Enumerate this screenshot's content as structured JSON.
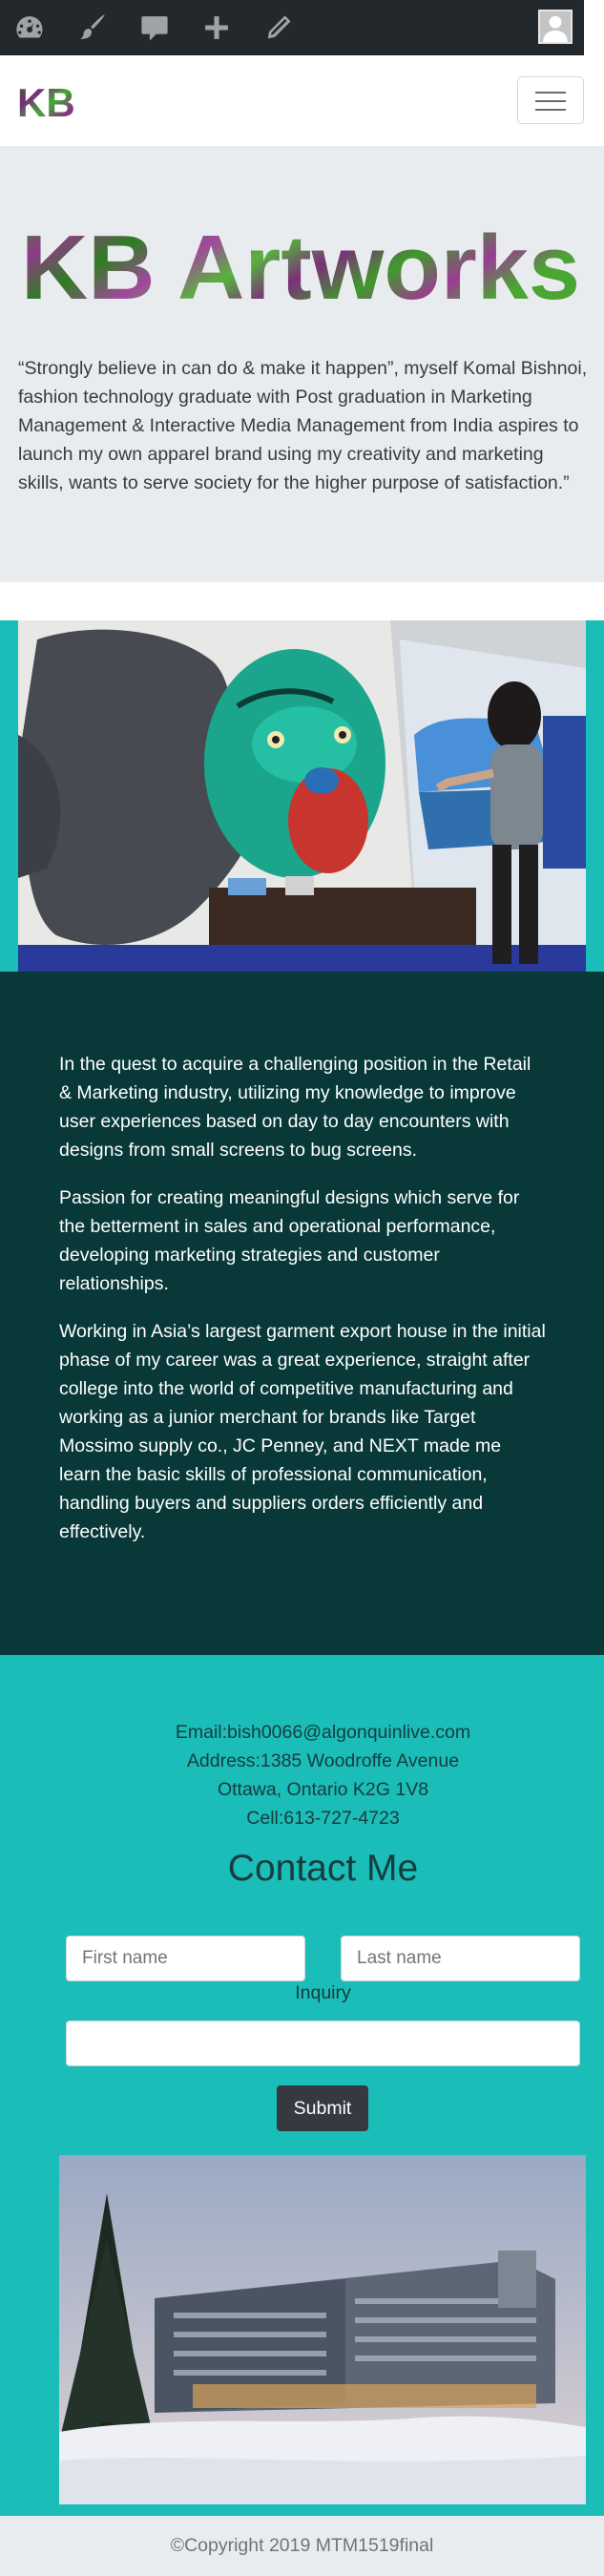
{
  "adminbar": {
    "icons": [
      "dashboard-icon",
      "brush-icon",
      "comment-icon",
      "plus-icon",
      "pencil-icon",
      "avatar-icon"
    ]
  },
  "navbar": {
    "brand": "KB"
  },
  "hero": {
    "title": "KB Artworks",
    "quote": "“Strongly believe in can do & make it happen”, myself Komal Bishnoi, fashion technology graduate with Post graduation in Marketing Management & Interactive Media Management from India aspires to launch my own apparel brand using my creativity and marketing skills, wants to serve society  for the higher purpose of satisfaction.”"
  },
  "about": {
    "paragraphs": [
      "In the quest to acquire a challenging position in the Retail & Marketing industry, utilizing my knowledge to improve user experiences based on day to day encounters with designs from small screens to bug screens.",
      "Passion for creating meaningful designs which serve for the betterment in sales and operational performance, developing marketing strategies and customer relationships.",
      "Working in Asia’s largest garment export house in the initial phase of my career was a great experience, straight after college into the world of competitive manufacturing and working as a junior merchant for brands like Target Mossimo supply co., JC Penney, and NEXT made me learn the basic skills of professional communication, handling buyers and suppliers orders efficiently and effectively."
    ]
  },
  "contact": {
    "email": "Email:bish0066@algonquinlive.com",
    "address": "Address:1385 Woodroffe Avenue",
    "city": "Ottawa, Ontario K2G 1V8",
    "cell": "Cell:613-727-4723",
    "title": "Contact Me",
    "first_name_placeholder": "First name",
    "last_name_placeholder": "Last name",
    "inquiry_label": "Inquiry",
    "inquiry_value": "",
    "submit_label": "Submit"
  },
  "footer": {
    "copyright": "©Copyright 2019 MTM1519final"
  },
  "colors": {
    "adminbar": "#23282d",
    "teal": "#1bbdb9",
    "dark_teal": "#083838",
    "hero_bg": "#e9ecef",
    "button": "#343a40"
  }
}
